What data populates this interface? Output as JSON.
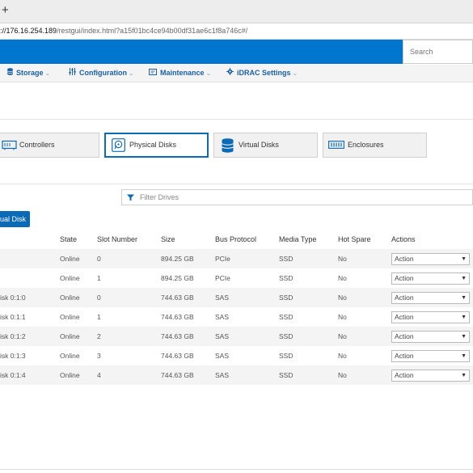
{
  "browser": {
    "new_tab": "+",
    "url_host": "://176.16.254.189",
    "url_rest": "/restgui/index.html?a15f01bc4ce94b00df31ae6c1f8a746c#/"
  },
  "header": {
    "search_placeholder": "Search",
    "brand_color": "#0076ce"
  },
  "nav": [
    {
      "label": "Storage",
      "icon": "database-icon"
    },
    {
      "label": "Configuration",
      "icon": "sliders-icon"
    },
    {
      "label": "Maintenance",
      "icon": "monitor-icon"
    },
    {
      "label": "iDRAC Settings",
      "icon": "gear-icon"
    }
  ],
  "cards": [
    {
      "label": "Controllers",
      "icon": "controller-icon"
    },
    {
      "label": "Physical Disks",
      "icon": "physical-disk-icon",
      "active": true
    },
    {
      "label": "Virtual Disks",
      "icon": "virtual-disk-icon"
    },
    {
      "label": "Enclosures",
      "icon": "enclosure-icon"
    }
  ],
  "filter": {
    "placeholder": "Filter Drives"
  },
  "button": {
    "virtual_disk": "ual Disk"
  },
  "table": {
    "columns": [
      "State",
      "Slot Number",
      "Size",
      "Bus Protocol",
      "Media Type",
      "Hot Spare",
      "Actions"
    ],
    "rows": [
      {
        "name": "",
        "state": "Online",
        "slot": "0",
        "size": "894.25 GB",
        "bus": "PCIe",
        "media": "SSD",
        "hot_spare": "No",
        "action": "Action"
      },
      {
        "name": "",
        "state": "Online",
        "slot": "1",
        "size": "894.25 GB",
        "bus": "PCIe",
        "media": "SSD",
        "hot_spare": "No",
        "action": "Action"
      },
      {
        "name": "isk 0:1:0",
        "state": "Online",
        "slot": "0",
        "size": "744.63 GB",
        "bus": "SAS",
        "media": "SSD",
        "hot_spare": "No",
        "action": "Action"
      },
      {
        "name": "isk 0:1:1",
        "state": "Online",
        "slot": "1",
        "size": "744.63 GB",
        "bus": "SAS",
        "media": "SSD",
        "hot_spare": "No",
        "action": "Action"
      },
      {
        "name": "isk 0:1:2",
        "state": "Online",
        "slot": "2",
        "size": "744.63 GB",
        "bus": "SAS",
        "media": "SSD",
        "hot_spare": "No",
        "action": "Action"
      },
      {
        "name": "isk 0:1:3",
        "state": "Online",
        "slot": "3",
        "size": "744.63 GB",
        "bus": "SAS",
        "media": "SSD",
        "hot_spare": "No",
        "action": "Action"
      },
      {
        "name": "isk 0:1:4",
        "state": "Online",
        "slot": "4",
        "size": "744.63 GB",
        "bus": "SAS",
        "media": "SSD",
        "hot_spare": "No",
        "action": "Action"
      }
    ]
  }
}
